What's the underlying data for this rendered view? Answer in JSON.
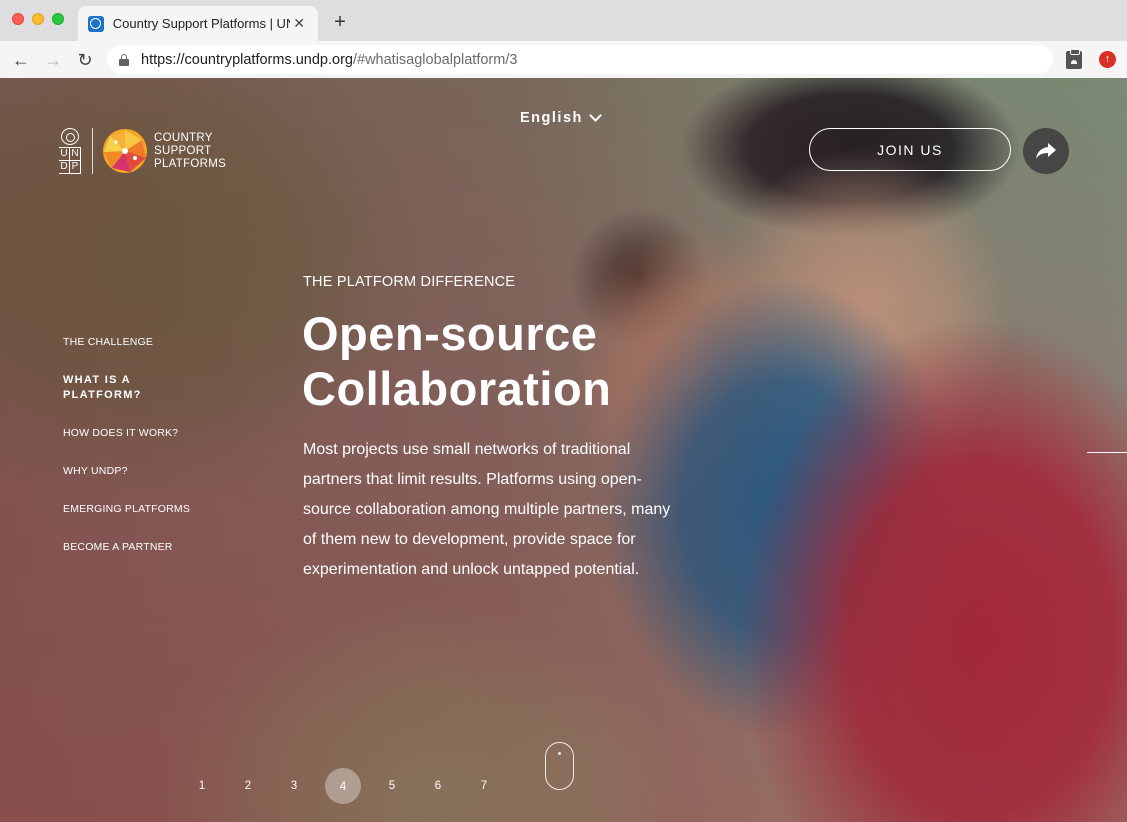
{
  "browser": {
    "tab_title": "Country Support Platforms | UNDP",
    "url_host": "https://countryplatforms.undp.org",
    "url_rest": "/#whatisaglobalplatform/3"
  },
  "logo": {
    "un_letters": [
      "U",
      "N",
      "D",
      "P"
    ],
    "csp_line1": "COUNTRY",
    "csp_line2": "SUPPORT",
    "csp_line3": "PLATFORMS"
  },
  "header": {
    "language": "English",
    "join_label": "JOIN US"
  },
  "sidenav": {
    "items": [
      {
        "label": "THE CHALLENGE"
      },
      {
        "label": "WHAT IS A PLATFORM?"
      },
      {
        "label": "HOW DOES IT WORK?"
      },
      {
        "label": "WHY UNDP?"
      },
      {
        "label": "EMERGING PLATFORMS"
      },
      {
        "label": "BECOME A PARTNER"
      }
    ],
    "active_index": 1
  },
  "main": {
    "eyebrow": "THE PLATFORM DIFFERENCE",
    "headline": "Open-source Collaboration",
    "body": "Most projects use small networks of traditional partners that limit results. Platforms using open-source collaboration among multiple partners, many of them new to development, provide space for experimentation and unlock untapped potential."
  },
  "pager": {
    "pages": [
      "1",
      "2",
      "3",
      "4",
      "5",
      "6",
      "7"
    ],
    "active": "4"
  },
  "colors": {
    "overlay": "#7a3034",
    "chrome": "#dedede",
    "white": "#ffffff"
  }
}
